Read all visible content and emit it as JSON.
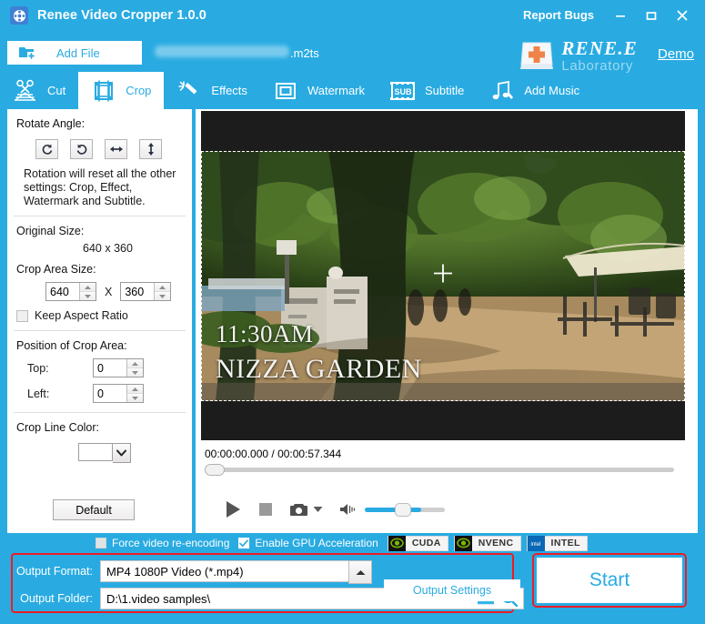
{
  "window": {
    "title": "Renee Video Cropper 1.0.0",
    "report_bugs": "Report Bugs",
    "minimize": "−",
    "maximize": "□",
    "close": "✕"
  },
  "brand": {
    "name": "RENE.E",
    "sub": "Laboratory",
    "demo": "Demo"
  },
  "toolbar": {
    "add_file": "Add File",
    "file_extension": ".m2ts"
  },
  "tabs": [
    {
      "label": "Cut",
      "icon": "scissors-icon",
      "active": false
    },
    {
      "label": "Crop",
      "icon": "film-frame-icon",
      "active": true
    },
    {
      "label": "Effects",
      "icon": "magic-wand-icon",
      "active": false
    },
    {
      "label": "Watermark",
      "icon": "watermark-icon",
      "active": false
    },
    {
      "label": "Subtitle",
      "icon": "subtitle-icon",
      "active": false
    },
    {
      "label": "Add Music",
      "icon": "music-note-icon",
      "active": false
    }
  ],
  "crop_panel": {
    "rotate_angle_label": "Rotate Angle:",
    "rotate_buttons": [
      {
        "name": "rotate-clockwise",
        "glyph": "↻"
      },
      {
        "name": "rotate-counterclockwise",
        "glyph": "↺"
      },
      {
        "name": "flip-horizontal",
        "glyph": "↔"
      },
      {
        "name": "flip-vertical",
        "glyph": "↕"
      }
    ],
    "note": "Rotation will reset all the other settings: Crop, Effect, Watermark and Subtitle.",
    "original_size_label": "Original Size:",
    "original_size_value": "640 x 360",
    "crop_area_size_label": "Crop Area Size:",
    "crop_width": "640",
    "crop_height": "360",
    "size_separator": "X",
    "keep_aspect_ratio_label": "Keep Aspect Ratio",
    "keep_aspect_ratio_checked": false,
    "position_label": "Position of Crop Area:",
    "top_label": "Top:",
    "top_value": "0",
    "left_label": "Left:",
    "left_value": "0",
    "crop_line_color_label": "Crop Line Color:",
    "crop_line_color": "#ffffff",
    "default_button": "Default"
  },
  "player": {
    "overlay_time": "11:30AM",
    "overlay_place": "NIZZA GARDEN",
    "time_readout": "00:00:00.000 / 00:00:57.344",
    "current_time": "00:00:00.000",
    "total_time": "00:00:57.344",
    "seek_percent": 0,
    "volume_percent": 70,
    "controls": [
      {
        "name": "play-button",
        "label": "Play"
      },
      {
        "name": "stop-button",
        "label": "Stop"
      },
      {
        "name": "snapshot-button",
        "label": "Snapshot"
      },
      {
        "name": "snapshot-dropdown",
        "label": "Snapshot options"
      },
      {
        "name": "volume-icon",
        "label": "Volume"
      }
    ]
  },
  "bottom": {
    "force_reencoding_label": "Force video re-encoding",
    "force_reencoding_checked": false,
    "gpu_acceleration_label": "Enable GPU Acceleration",
    "gpu_acceleration_checked": true,
    "gpu_badges": [
      "CUDA",
      "NVENC",
      "INTEL"
    ],
    "output_format_label": "Output Format:",
    "output_format_value": "MP4 1080P Video (*.mp4)",
    "output_folder_label": "Output Folder:",
    "output_folder_value": "D:\\1.video samples\\",
    "output_settings_button": "Output Settings",
    "start_button": "Start"
  },
  "colors": {
    "brand_blue": "#29abe2",
    "highlight_red": "#ee1c25",
    "panel_white": "#ffffff"
  }
}
